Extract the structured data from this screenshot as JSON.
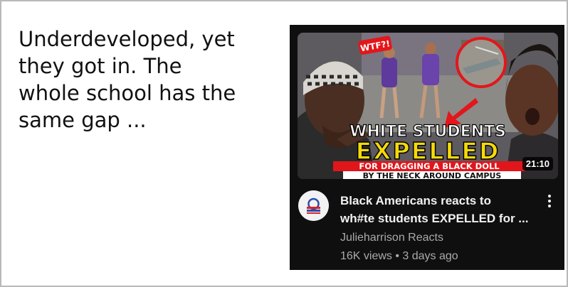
{
  "post": {
    "caption_lines": [
      "Underdeveloped, yet",
      "they got in. The",
      "whole school has the",
      "same gap ..."
    ]
  },
  "video": {
    "title_lines": [
      "Black Americans reacts to",
      "wh#te students EXPELLED for ..."
    ],
    "channel": "Julieharrison Reacts",
    "meta": "16K views • 3 days ago",
    "duration": "21:10",
    "thumbnail": {
      "badge": "WTF?!",
      "headline_1": "WHITE STUDENTS",
      "headline_2": "EXPELLED",
      "subline_1": "FOR DRAGGING A BLACK DOLL",
      "subline_2": "BY THE NECK AROUND CAMPUS",
      "colors": {
        "headline": "#ffffff",
        "expelled": "#f5d90a",
        "subline_bg": "#e0161b",
        "subline2_bg": "#ffffff"
      }
    }
  },
  "icons": {
    "more": "more-vert-icon",
    "avatar_logo": "flag-logo-icon"
  },
  "colors": {
    "card_bg": "#0f0f0f",
    "title": "#f1f1f1",
    "secondary": "#aaaaaa",
    "frame_border": "#b9b9b9"
  }
}
